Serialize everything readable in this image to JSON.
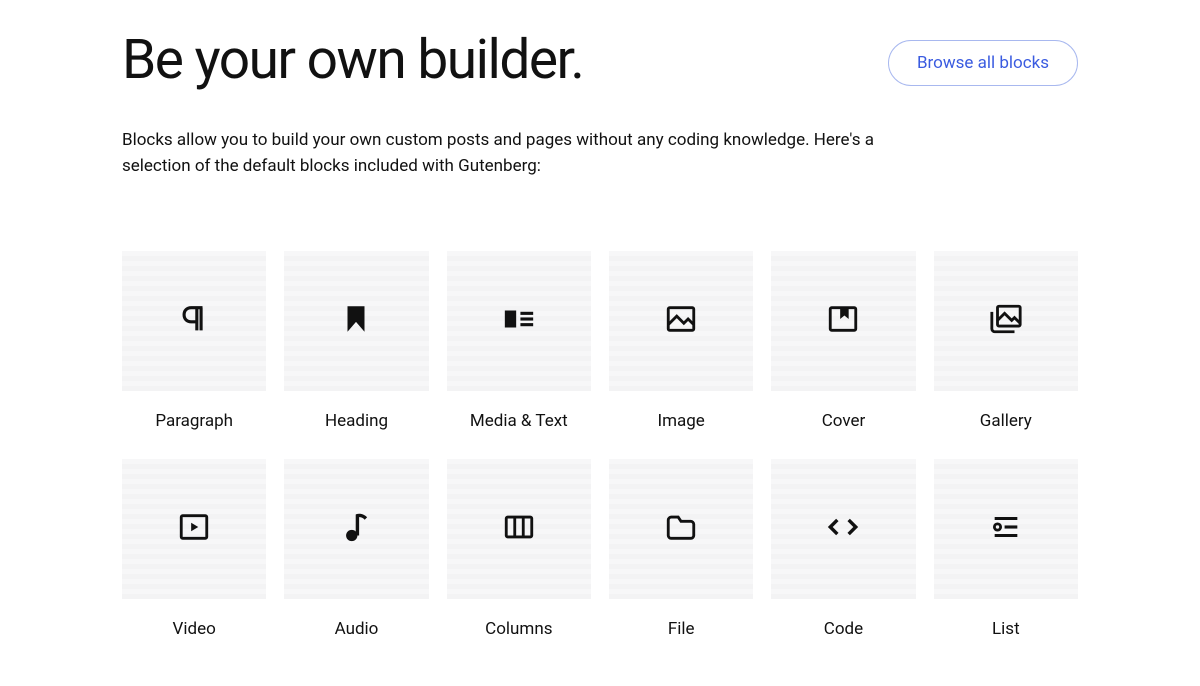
{
  "header": {
    "title": "Be your own builder.",
    "browse_button": "Browse all blocks",
    "description": "Blocks allow you to build your own custom posts and pages without any coding knowledge. Here's a selection of the default blocks included with Gutenberg:"
  },
  "blocks": [
    {
      "label": "Paragraph",
      "icon": "paragraph-icon"
    },
    {
      "label": "Heading",
      "icon": "heading-icon"
    },
    {
      "label": "Media & Text",
      "icon": "media-text-icon"
    },
    {
      "label": "Image",
      "icon": "image-icon"
    },
    {
      "label": "Cover",
      "icon": "cover-icon"
    },
    {
      "label": "Gallery",
      "icon": "gallery-icon"
    },
    {
      "label": "Video",
      "icon": "video-icon"
    },
    {
      "label": "Audio",
      "icon": "audio-icon"
    },
    {
      "label": "Columns",
      "icon": "columns-icon"
    },
    {
      "label": "File",
      "icon": "file-icon"
    },
    {
      "label": "Code",
      "icon": "code-icon"
    },
    {
      "label": "List",
      "icon": "list-icon"
    }
  ]
}
